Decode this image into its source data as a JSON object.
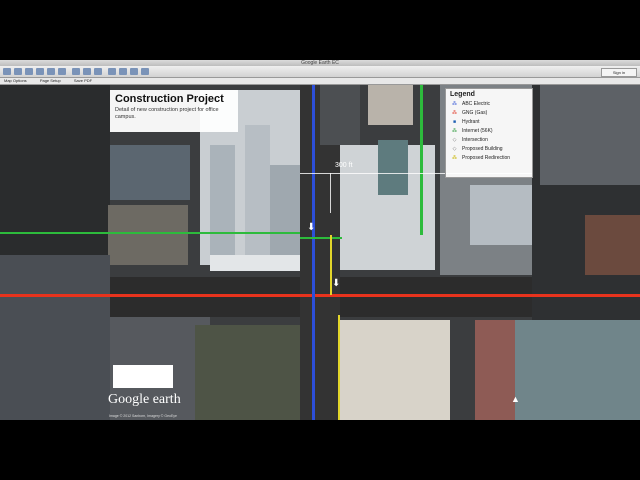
{
  "window": {
    "title": "Google Earth EC"
  },
  "toolbar": {
    "signin_label": "Sign in"
  },
  "menubar": {
    "items": [
      "Map Options",
      "Page Setup",
      "Save PDF"
    ]
  },
  "info_panel": {
    "title": "Construction Project",
    "description": "Detail of new construction project for office campus."
  },
  "legend": {
    "title": "Legend",
    "items": [
      {
        "label": "ABC Electric",
        "icon": "electric-icon",
        "color": "#3b5bd6",
        "symbol": "⁂"
      },
      {
        "label": "GNG (Gas)",
        "icon": "gas-icon",
        "color": "#e03a2a",
        "symbol": "⁂"
      },
      {
        "label": "Hydrant",
        "icon": "hydrant-icon",
        "color": "#1e5fb3",
        "symbol": "■"
      },
      {
        "label": "Internet (56K)",
        "icon": "internet-icon",
        "color": "#2e9a3c",
        "symbol": "⁂"
      },
      {
        "label": "Intersection",
        "icon": "intersection-icon",
        "color": "#777777",
        "symbol": "◇"
      },
      {
        "label": "Proposed Building",
        "icon": "building-icon",
        "color": "#777777",
        "symbol": "◇"
      },
      {
        "label": "Proposed Redirection",
        "icon": "redirection-icon",
        "color": "#c8b400",
        "symbol": "⁂"
      }
    ]
  },
  "map": {
    "distance_label": "300 ft"
  },
  "branding": {
    "logo_text": "Google earth",
    "copyright": "Image © 2012 Sanborn, Imagery © GeoEye"
  }
}
